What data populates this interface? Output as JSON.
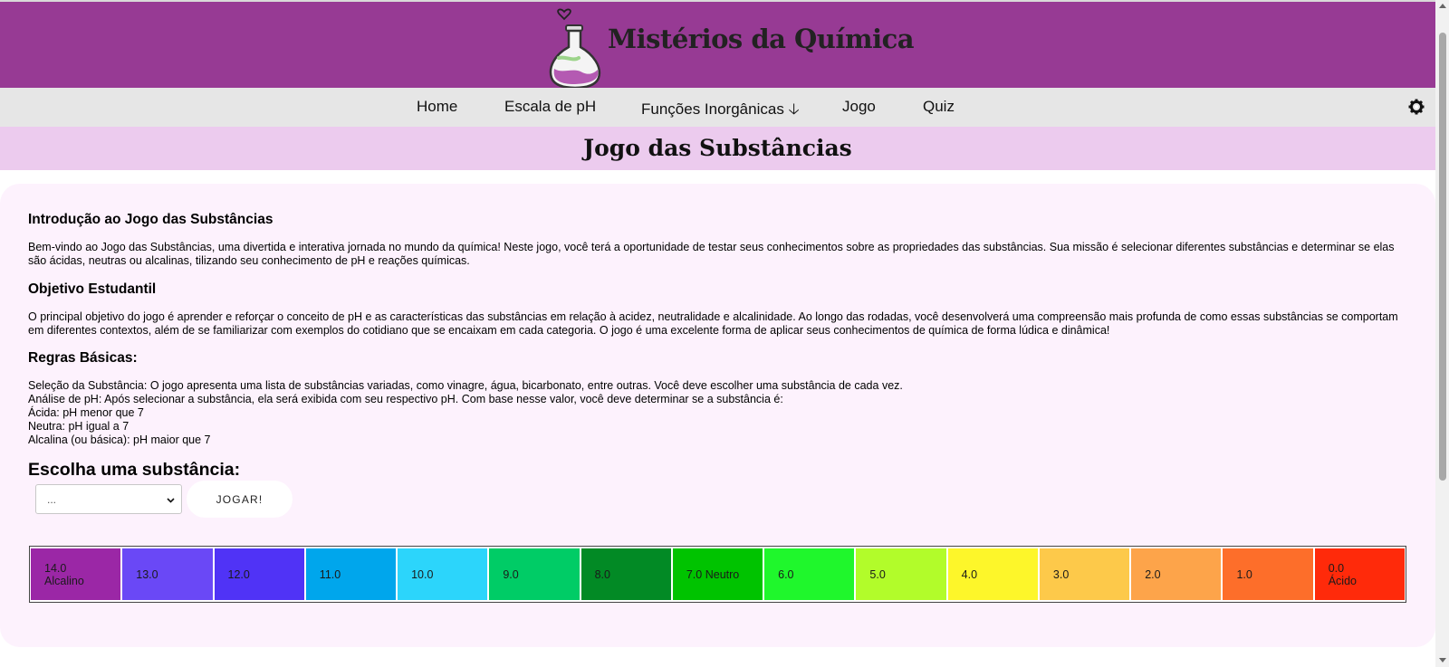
{
  "header": {
    "site_title": "Mistérios da Química"
  },
  "nav": {
    "items": [
      {
        "label": "Home"
      },
      {
        "label": "Escala de pH"
      },
      {
        "label": "Funções Inorgânicas 🡣"
      },
      {
        "label": "Jogo"
      },
      {
        "label": "Quiz"
      }
    ],
    "settings_icon": "gear-icon"
  },
  "page": {
    "title": "Jogo das Substâncias"
  },
  "content": {
    "intro_heading": "Introdução ao Jogo das Substâncias",
    "intro_text": "Bem-vindo ao Jogo das Substâncias, uma divertida e interativa jornada no mundo da química! Neste jogo, você terá a oportunidade de testar seus conhecimentos sobre as propriedades das substâncias. Sua missão é selecionar diferentes substâncias e determinar se elas são ácidas, neutras ou alcalinas, tilizando seu conhecimento de pH e reações químicas.",
    "objective_heading": "Objetivo Estudantil",
    "objective_text": "O principal objetivo do jogo é aprender e reforçar o conceito de pH e as características das substâncias em relação à acidez, neutralidade e alcalinidade. Ao longo das rodadas, você desenvolverá uma compreensão mais profunda de como essas substâncias se comportam em diferentes contextos, além de se familiarizar com exemplos do cotidiano que se encaixam em cada categoria. O jogo é uma excelente forma de aplicar seus conhecimentos de química de forma lúdica e dinâmica!",
    "rules_heading": "Regras Básicas:",
    "rules_lines": [
      "Seleção da Substância: O jogo apresenta uma lista de substâncias variadas, como vinagre, água, bicarbonato, entre outras. Você deve escolher uma substância de cada vez.",
      "Análise de pH: Após selecionar a substância, ela será exibida com seu respectivo pH. Com base nesse valor, você deve determinar se a substância é:",
      "Ácida: pH menor que 7",
      "Neutra: pH igual a 7",
      "Alcalina (ou básica): pH maior que 7"
    ]
  },
  "game": {
    "choose_heading": "Escolha uma substância:",
    "select_value": "...",
    "play_button": "JOGAR!"
  },
  "ph_scale": [
    {
      "line1": "14.0",
      "line2": "Alcalino",
      "color": "#9b27a6"
    },
    {
      "line1": "13.0",
      "line2": "",
      "color": "#6a48f6"
    },
    {
      "line1": "12.0",
      "line2": "",
      "color": "#5033f6"
    },
    {
      "line1": "11.0",
      "line2": "",
      "color": "#00a6ec"
    },
    {
      "line1": "10.0",
      "line2": "",
      "color": "#2cd5fb"
    },
    {
      "line1": "9.0",
      "line2": "",
      "color": "#00cc66"
    },
    {
      "line1": "8.0",
      "line2": "",
      "color": "#028a25"
    },
    {
      "line1": "7.0 Neutro",
      "line2": "",
      "color": "#00c300"
    },
    {
      "line1": "6.0",
      "line2": "",
      "color": "#1ff72c"
    },
    {
      "line1": "5.0",
      "line2": "",
      "color": "#b2fc2a"
    },
    {
      "line1": "4.0",
      "line2": "",
      "color": "#fdf62a"
    },
    {
      "line1": "3.0",
      "line2": "",
      "color": "#fdc94a"
    },
    {
      "line1": "2.0",
      "line2": "",
      "color": "#fda44a"
    },
    {
      "line1": "1.0",
      "line2": "",
      "color": "#fd6e2a"
    },
    {
      "line1": "0.0",
      "line2": "Ácido",
      "color": "#ff2a0a"
    }
  ]
}
